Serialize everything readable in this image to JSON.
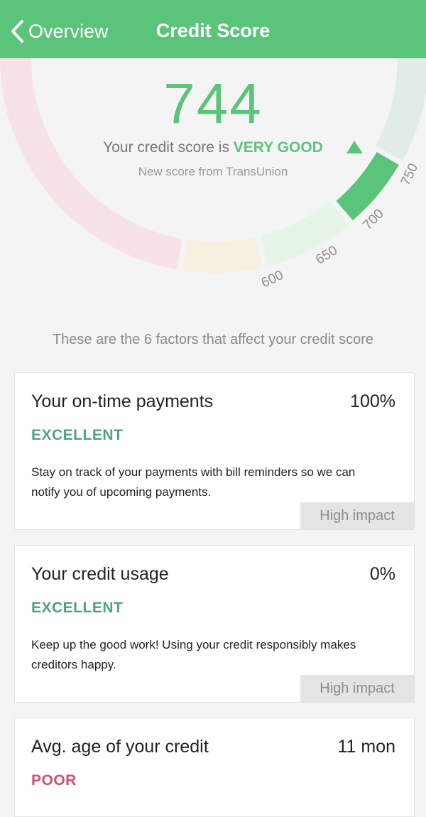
{
  "header": {
    "back_label": "Overview",
    "title": "Credit Score"
  },
  "score": {
    "value": "744",
    "prefix": "Your credit score is ",
    "rating": "VERY GOOD",
    "source": "New score from TransUnion"
  },
  "gauge": {
    "ticks": [
      "600",
      "650",
      "700",
      "750"
    ],
    "colors": {
      "poor": "#f7e3e5",
      "fair": "#f7efe0",
      "good": "#e7f5e8",
      "very_good": "#5ac57a",
      "excellent": "#e1ece8",
      "pointer": "#5ac57a"
    }
  },
  "factors_intro": "These are the 6 factors that affect your credit score",
  "factors": [
    {
      "title": "Your on-time payments",
      "value": "100%",
      "rating": "EXCELLENT",
      "rating_color": "#4ba57a",
      "description": "Stay on track of your payments with bill reminders so we can notify you of upcoming payments.",
      "impact": "High impact"
    },
    {
      "title": "Your credit usage",
      "value": "0%",
      "rating": "EXCELLENT",
      "rating_color": "#4ba57a",
      "description": "Keep up the good work! Using your credit responsibly makes creditors happy.",
      "impact": "High impact"
    },
    {
      "title": "Avg. age of your credit",
      "value": "11 mon",
      "rating": "POOR",
      "rating_color": "#d94f6b"
    }
  ]
}
